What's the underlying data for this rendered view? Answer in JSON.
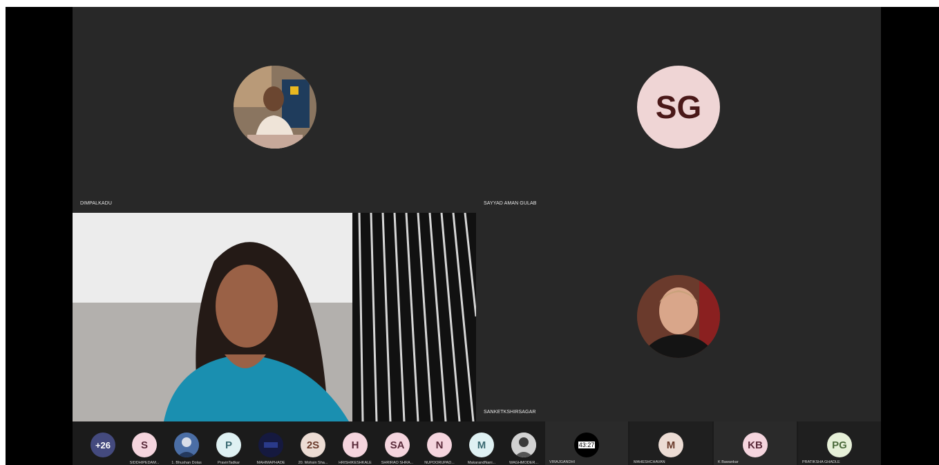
{
  "tiles": {
    "top_left": {
      "name": "DIMPALKADU"
    },
    "top_right": {
      "name": "SAYYAD AMAN GULAB",
      "initials": "SG"
    },
    "bottom_right": {
      "name": "SANKETKSHIRSAGAR"
    }
  },
  "strip": {
    "overflow_count": "+26",
    "participants": [
      {
        "initials": "S",
        "label": "SIDDHIPEDAM..."
      },
      {
        "initials": "",
        "label": "1. Bhushan Dolas"
      },
      {
        "initials": "P",
        "label": "PravinTadkar"
      },
      {
        "initials": "",
        "label": "MAHIMAPHADE"
      },
      {
        "initials": "2S",
        "label": "20. Mohsin Sha..."
      },
      {
        "initials": "H",
        "label": "HRISHIKESHKALE"
      },
      {
        "initials": "SA",
        "label": "SHRIRAO SHRA..."
      },
      {
        "initials": "N",
        "label": "NUPOORUPAD..."
      },
      {
        "initials": "M",
        "label": "MakarandNani..."
      },
      {
        "initials": "",
        "label": "WAGHMODER..."
      }
    ],
    "large_cells": [
      {
        "initials": "43:27",
        "label": "VIRAJGANDHI"
      },
      {
        "initials": "M",
        "label": "MAHESHCHAVAN"
      },
      {
        "initials": "KB",
        "label": "K Bawankar"
      },
      {
        "initials": "PG",
        "label": "PRATIKSHA GHADLE"
      }
    ]
  },
  "colors": {
    "tile_bg": "#282828",
    "sg_avatar": "#efd5d5",
    "chip_pink": "#f5d5de",
    "chip_blue": "#dff1f3",
    "chip_beige": "#ecdcd4",
    "overflow_chip": "#444a7e"
  }
}
